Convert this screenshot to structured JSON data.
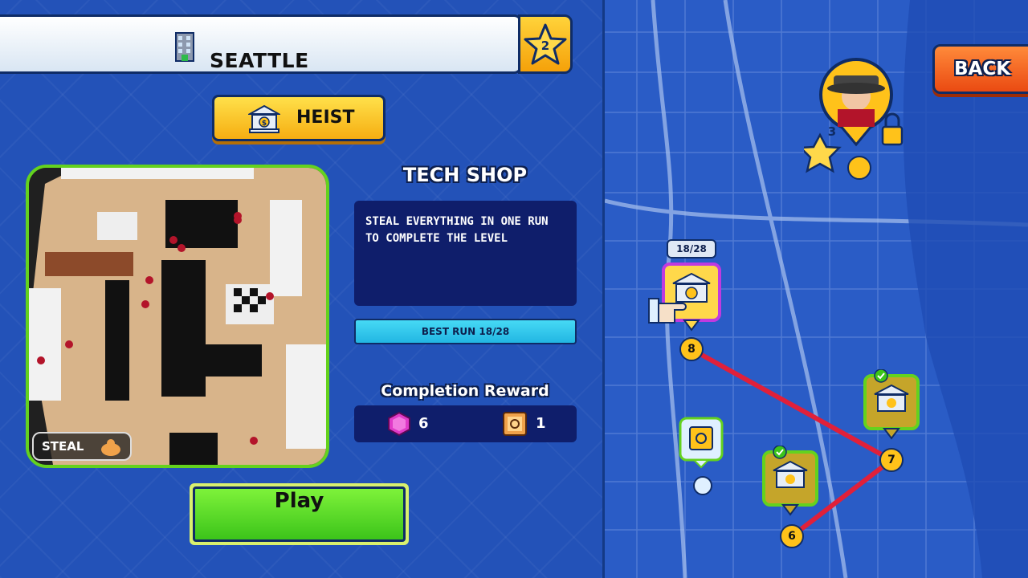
{
  "header": {
    "city_name": "SEATTLE",
    "city_stars": "2"
  },
  "mode": {
    "label": "HEIST"
  },
  "preview": {
    "steal_label": "STEAL"
  },
  "level": {
    "title": "TECH SHOP",
    "description": "STEAL EVERYTHING IN ONE RUN TO COMPLETE THE LEVEL",
    "best_run": "BEST RUN 18/28"
  },
  "reward": {
    "title": "Completion Reward",
    "items": [
      {
        "icon": "pink-gem-icon",
        "count": "6"
      },
      {
        "icon": "safe-icon",
        "count": "1"
      }
    ]
  },
  "play": {
    "label": "Play"
  },
  "map": {
    "back_label": "BACK",
    "boss_stars": "3",
    "current_progress": "18/28",
    "nodes": [
      {
        "number": "8",
        "type": "heist",
        "state": "current"
      },
      {
        "number": "7",
        "type": "heist",
        "state": "completed"
      },
      {
        "number": "6",
        "type": "heist",
        "state": "completed"
      },
      {
        "number": "",
        "type": "safe",
        "state": "available"
      },
      {
        "number": "",
        "type": "boss",
        "state": "locked"
      }
    ]
  },
  "colors": {
    "accent_yellow": "#ffc21a",
    "play_green": "#3cc41a",
    "back_orange": "#ea4a12",
    "panel_navy": "#0f1e6b",
    "route_red": "#e0203a"
  }
}
